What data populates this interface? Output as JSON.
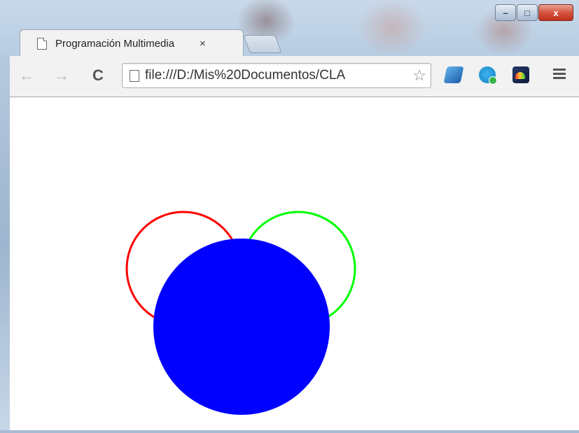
{
  "window": {
    "controls": {
      "minimize": "–",
      "maximize": "□",
      "close": "x"
    }
  },
  "tab": {
    "title": "Programación Multimedia",
    "close": "×"
  },
  "toolbar": {
    "back": "←",
    "forward": "→",
    "reload": "C",
    "url": "file:///D:/Mis%20Documentos/CLA",
    "bookmark_star": "☆",
    "extensions": [
      "extension-icon",
      "skype-icon",
      "speed-dial-icon"
    ],
    "menu": "menu-icon"
  },
  "page": {
    "circles": [
      {
        "name": "red-outline-circle",
        "stroke": "#ff0000",
        "fill": "none"
      },
      {
        "name": "green-outline-circle",
        "stroke": "#00ff00",
        "fill": "none"
      },
      {
        "name": "blue-filled-circle",
        "stroke": "none",
        "fill": "#0000ff"
      }
    ]
  }
}
